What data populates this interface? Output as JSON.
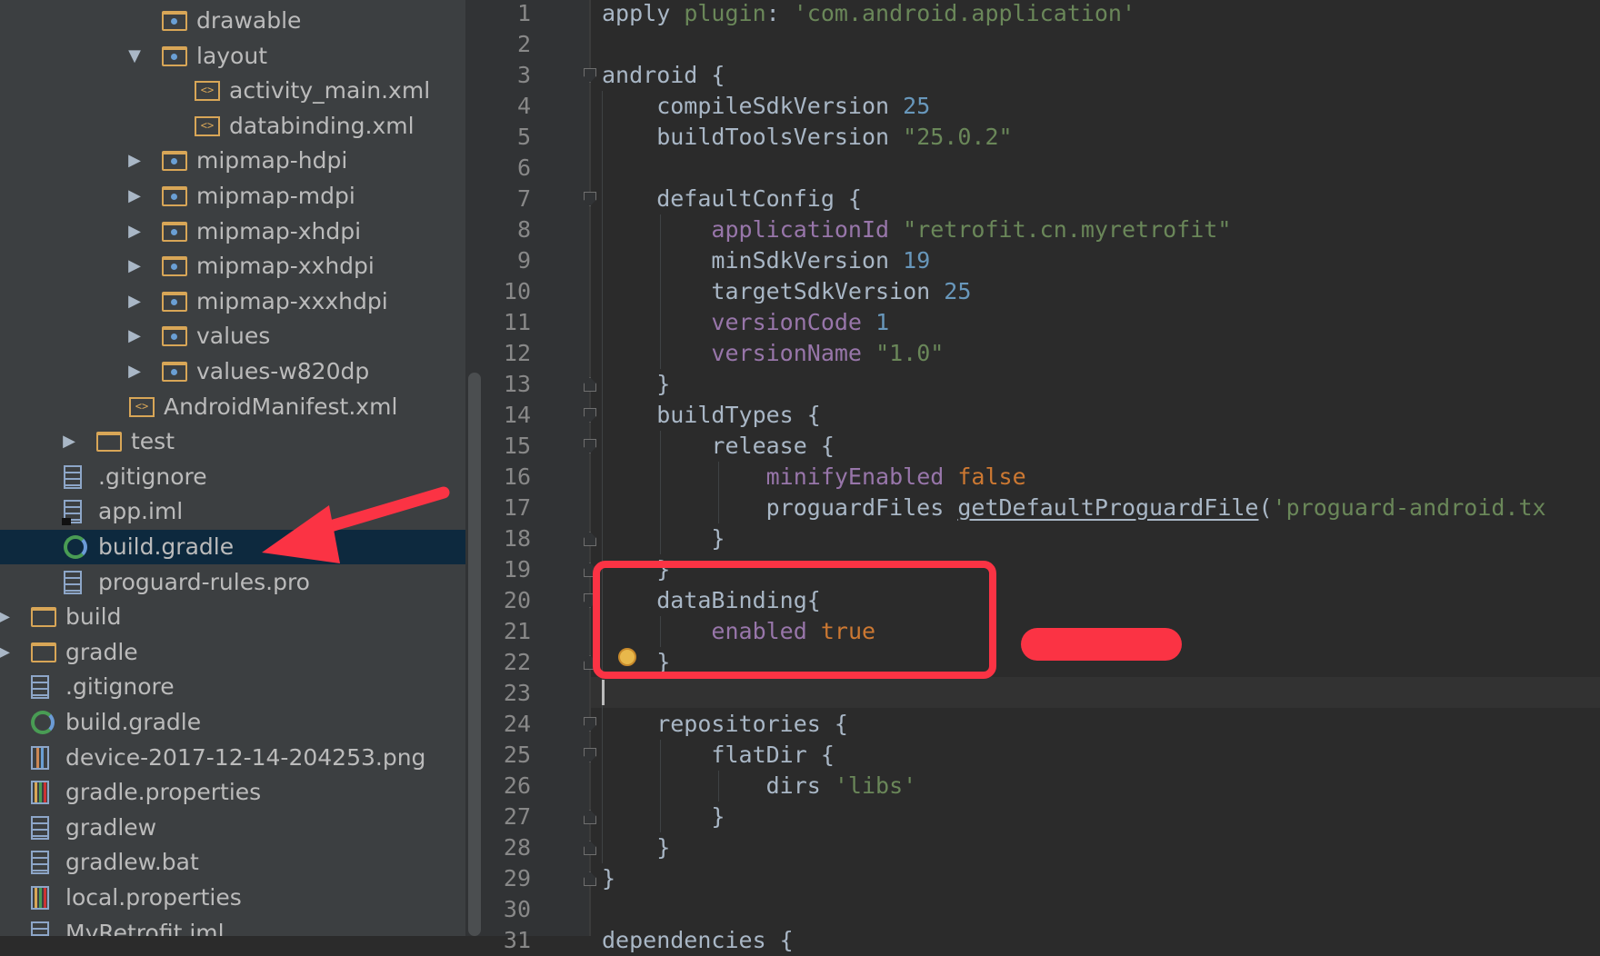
{
  "project_tree": [
    {
      "label": "drawable",
      "type": "res-folder",
      "depth": 4,
      "arrow": ""
    },
    {
      "label": "layout",
      "type": "res-folder",
      "depth": 4,
      "arrow": "expanded"
    },
    {
      "label": "activity_main.xml",
      "type": "xml",
      "depth": 5,
      "arrow": ""
    },
    {
      "label": "databinding.xml",
      "type": "xml",
      "depth": 5,
      "arrow": ""
    },
    {
      "label": "mipmap-hdpi",
      "type": "res-folder",
      "depth": 4,
      "arrow": "collapsed"
    },
    {
      "label": "mipmap-mdpi",
      "type": "res-folder",
      "depth": 4,
      "arrow": "collapsed"
    },
    {
      "label": "mipmap-xhdpi",
      "type": "res-folder",
      "depth": 4,
      "arrow": "collapsed"
    },
    {
      "label": "mipmap-xxhdpi",
      "type": "res-folder",
      "depth": 4,
      "arrow": "collapsed"
    },
    {
      "label": "mipmap-xxxhdpi",
      "type": "res-folder",
      "depth": 4,
      "arrow": "collapsed"
    },
    {
      "label": "values",
      "type": "res-folder",
      "depth": 4,
      "arrow": "collapsed"
    },
    {
      "label": "values-w820dp",
      "type": "res-folder",
      "depth": 4,
      "arrow": "collapsed"
    },
    {
      "label": "AndroidManifest.xml",
      "type": "xml",
      "depth": 3,
      "arrow": ""
    },
    {
      "label": "test",
      "type": "folder",
      "depth": 2,
      "arrow": "collapsed"
    },
    {
      "label": ".gitignore",
      "type": "file",
      "depth": 1,
      "arrow": ""
    },
    {
      "label": "app.iml",
      "type": "iml",
      "depth": 1,
      "arrow": ""
    },
    {
      "label": "build.gradle",
      "type": "gradle",
      "depth": 1,
      "arrow": "",
      "selected": true
    },
    {
      "label": "proguard-rules.pro",
      "type": "file",
      "depth": 1,
      "arrow": ""
    },
    {
      "label": "build",
      "type": "folder",
      "depth": 0,
      "arrow": "collapsed"
    },
    {
      "label": "gradle",
      "type": "folder",
      "depth": 0,
      "arrow": "collapsed"
    },
    {
      "label": ".gitignore",
      "type": "file",
      "depth": 0,
      "arrow": ""
    },
    {
      "label": "build.gradle",
      "type": "gradle",
      "depth": 0,
      "arrow": ""
    },
    {
      "label": "device-2017-12-14-204253.png",
      "type": "png",
      "depth": 0,
      "arrow": ""
    },
    {
      "label": "gradle.properties",
      "type": "properties",
      "depth": 0,
      "arrow": ""
    },
    {
      "label": "gradlew",
      "type": "file",
      "depth": 0,
      "arrow": ""
    },
    {
      "label": "gradlew.bat",
      "type": "file",
      "depth": 0,
      "arrow": ""
    },
    {
      "label": "local.properties",
      "type": "properties",
      "depth": 0,
      "arrow": ""
    },
    {
      "label": "MyRetrofit.iml",
      "type": "iml",
      "depth": 0,
      "arrow": ""
    }
  ],
  "editor": {
    "line_numbers": [
      "1",
      "2",
      "3",
      "4",
      "5",
      "6",
      "7",
      "8",
      "9",
      "10",
      "11",
      "12",
      "13",
      "14",
      "15",
      "16",
      "17",
      "18",
      "19",
      "20",
      "21",
      "22",
      "23",
      "24",
      "25",
      "26",
      "27",
      "28",
      "29",
      "30",
      "31"
    ],
    "lines": [
      [
        {
          "t": "apply "
        },
        {
          "t": "plugin",
          "c": "str"
        },
        {
          "t": ": "
        },
        {
          "t": "'com.android.application'",
          "c": "str"
        }
      ],
      [],
      [
        {
          "t": "android {"
        }
      ],
      [
        {
          "t": "    compileSdkVersion "
        },
        {
          "t": "25",
          "c": "num"
        }
      ],
      [
        {
          "t": "    buildToolsVersion "
        },
        {
          "t": "\"25.0.2\"",
          "c": "str"
        }
      ],
      [],
      [
        {
          "t": "    defaultConfig {"
        }
      ],
      [
        {
          "t": "        "
        },
        {
          "t": "applicationId",
          "c": "prop"
        },
        {
          "t": " "
        },
        {
          "t": "\"retrofit.cn.myretrofit\"",
          "c": "str"
        }
      ],
      [
        {
          "t": "        minSdkVersion "
        },
        {
          "t": "19",
          "c": "num"
        }
      ],
      [
        {
          "t": "        targetSdkVersion "
        },
        {
          "t": "25",
          "c": "num"
        }
      ],
      [
        {
          "t": "        "
        },
        {
          "t": "versionCode",
          "c": "prop"
        },
        {
          "t": " "
        },
        {
          "t": "1",
          "c": "num"
        }
      ],
      [
        {
          "t": "        "
        },
        {
          "t": "versionName",
          "c": "prop"
        },
        {
          "t": " "
        },
        {
          "t": "\"1.0\"",
          "c": "str"
        }
      ],
      [
        {
          "t": "    }"
        }
      ],
      [
        {
          "t": "    buildTypes {"
        }
      ],
      [
        {
          "t": "        release {"
        }
      ],
      [
        {
          "t": "            "
        },
        {
          "t": "minifyEnabled",
          "c": "prop"
        },
        {
          "t": " "
        },
        {
          "t": "false",
          "c": "kw"
        }
      ],
      [
        {
          "t": "            proguardFiles "
        },
        {
          "t": "getDefaultProguardFile",
          "c": "fn"
        },
        {
          "t": "("
        },
        {
          "t": "'proguard-android.tx",
          "c": "str"
        }
      ],
      [
        {
          "t": "        }"
        }
      ],
      [
        {
          "t": "    }"
        }
      ],
      [
        {
          "t": "    dataBinding{"
        }
      ],
      [
        {
          "t": "        "
        },
        {
          "t": "enabled",
          "c": "prop"
        },
        {
          "t": " "
        },
        {
          "t": "true",
          "c": "kw"
        }
      ],
      [
        {
          "t": "    }"
        }
      ],
      [],
      [
        {
          "t": "    repositories {"
        }
      ],
      [
        {
          "t": "        flatDir {"
        }
      ],
      [
        {
          "t": "            dirs "
        },
        {
          "t": "'libs'",
          "c": "str"
        }
      ],
      [
        {
          "t": "        }"
        }
      ],
      [
        {
          "t": "    }"
        }
      ],
      [
        {
          "t": "}"
        }
      ],
      [],
      [
        {
          "t": "dependencies {"
        }
      ]
    ],
    "fold_markers": {
      "3": "start",
      "7": "start",
      "13": "end",
      "14": "start",
      "15": "start",
      "18": "end",
      "19": "end",
      "20": "start",
      "22": "end",
      "24": "start",
      "25": "start",
      "27": "end",
      "28": "end",
      "29": "end"
    }
  },
  "annotations": {
    "highlight_color": "#fb3344",
    "arrow_target": "build.gradle"
  }
}
